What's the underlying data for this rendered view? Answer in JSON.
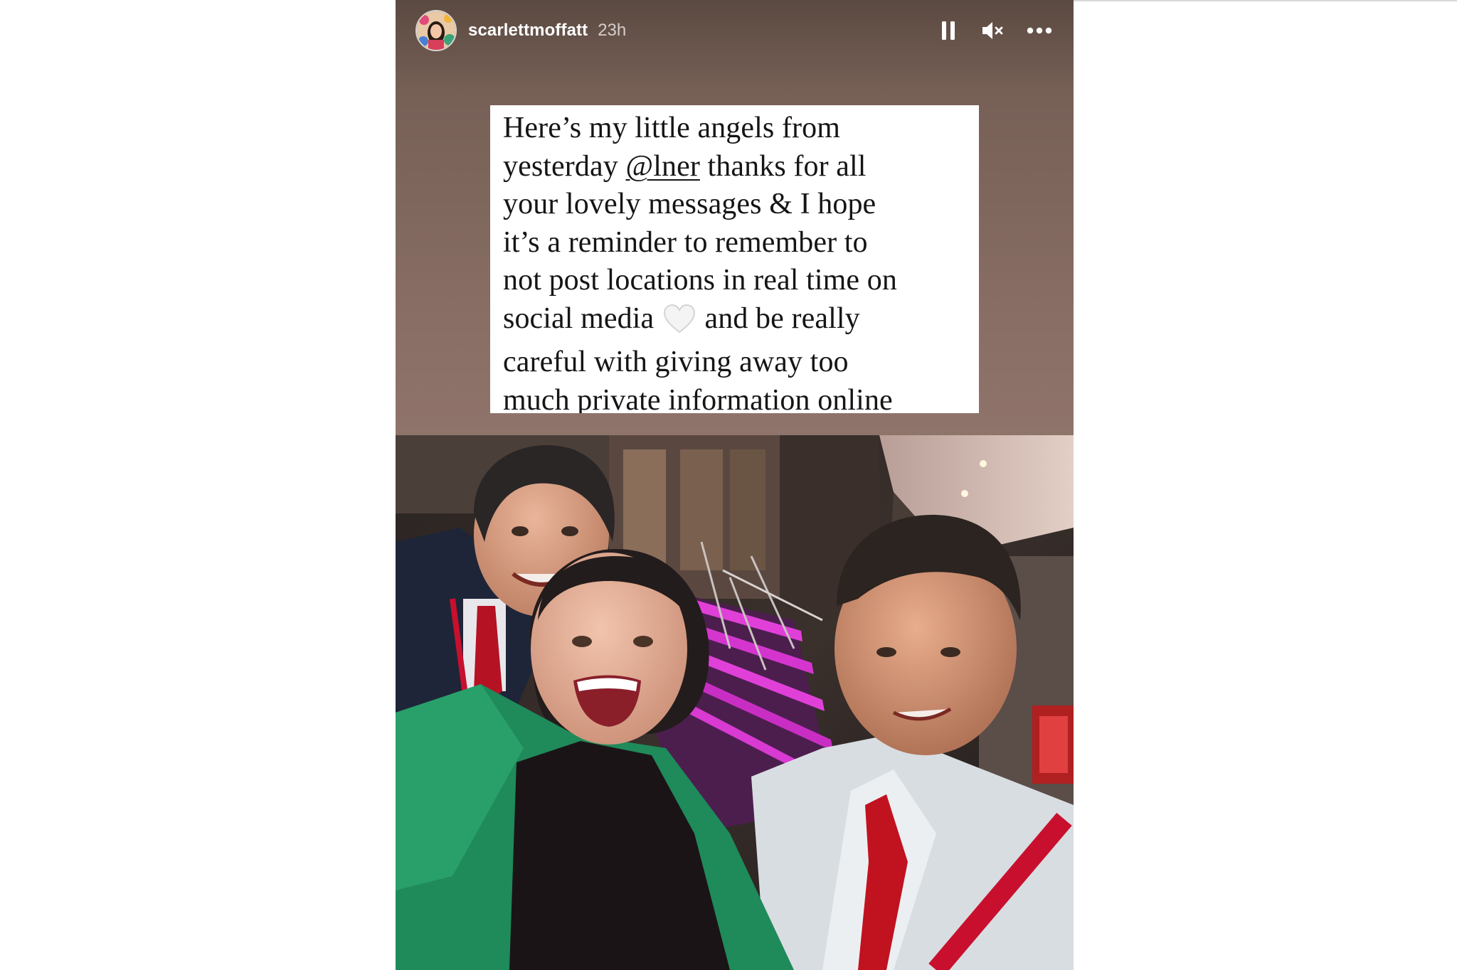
{
  "story": {
    "username": "scarlettmoffatt",
    "time_ago": "23h",
    "controls": {
      "pause_icon": "pause-icon",
      "mute_icon": "speaker-muted-icon",
      "more_icon": "more-horizontal-icon"
    },
    "caption": {
      "lines": [
        "Here’s my little angels from",
        "yesterday",
        "@lner",
        "thanks for all",
        "your lovely messages & I hope",
        "it’s a reminder to remember to",
        "not post locations in real time on",
        "social media",
        "and be really",
        "careful with giving away too",
        "much private information online"
      ],
      "emoji": "white-heart-emoji"
    },
    "photo": {
      "subject": "selfie-photo"
    }
  },
  "colors": {
    "story_background": "#8a6f66",
    "caption_background": "#ffffff",
    "caption_text": "#151515",
    "stair_light": "#e040d8",
    "cardigan": "#1f8a5a",
    "lanyard": "#c8102e"
  }
}
